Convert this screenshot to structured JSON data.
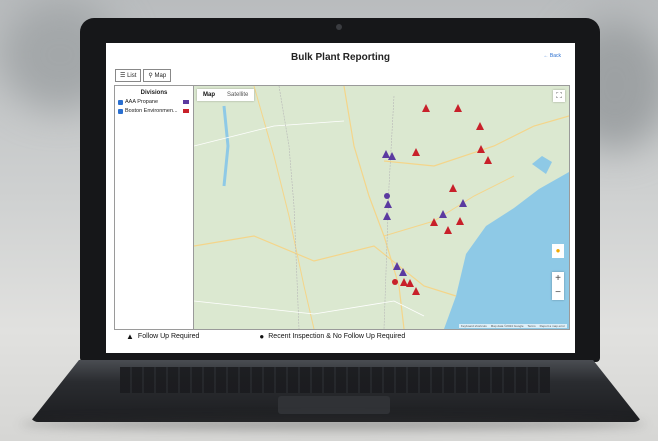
{
  "page": {
    "title": "Bulk Plant Reporting",
    "back_link": "← Back"
  },
  "view_toggle": [
    {
      "label": "List",
      "icon": "list-icon",
      "active": false
    },
    {
      "label": "Map",
      "icon": "map-pin-icon",
      "active": true
    }
  ],
  "divisions": {
    "heading": "Divisions",
    "items": [
      {
        "label": "AAA Propane",
        "checked": true,
        "color": "#5b3aa0"
      },
      {
        "label": "Boston Environmen...",
        "checked": true,
        "color": "#c8202a"
      }
    ]
  },
  "map": {
    "tabs": [
      {
        "label": "Map",
        "active": true
      },
      {
        "label": "Satellite",
        "active": false
      }
    ],
    "zoom_in": "+",
    "zoom_out": "−",
    "attribution": [
      "Keyboard shortcuts",
      "Map data ©2024 Google",
      "Terms",
      "Report a map error"
    ],
    "colors": {
      "land": "#dbe8d0",
      "water": "#8ec9e6",
      "road": "#f4d58a"
    }
  },
  "legend": [
    {
      "icon": "warning-triangle-icon",
      "label": "Follow Up Required"
    },
    {
      "icon": "check-circle-icon",
      "label": "Recent Inspection & No Follow Up Required"
    }
  ]
}
